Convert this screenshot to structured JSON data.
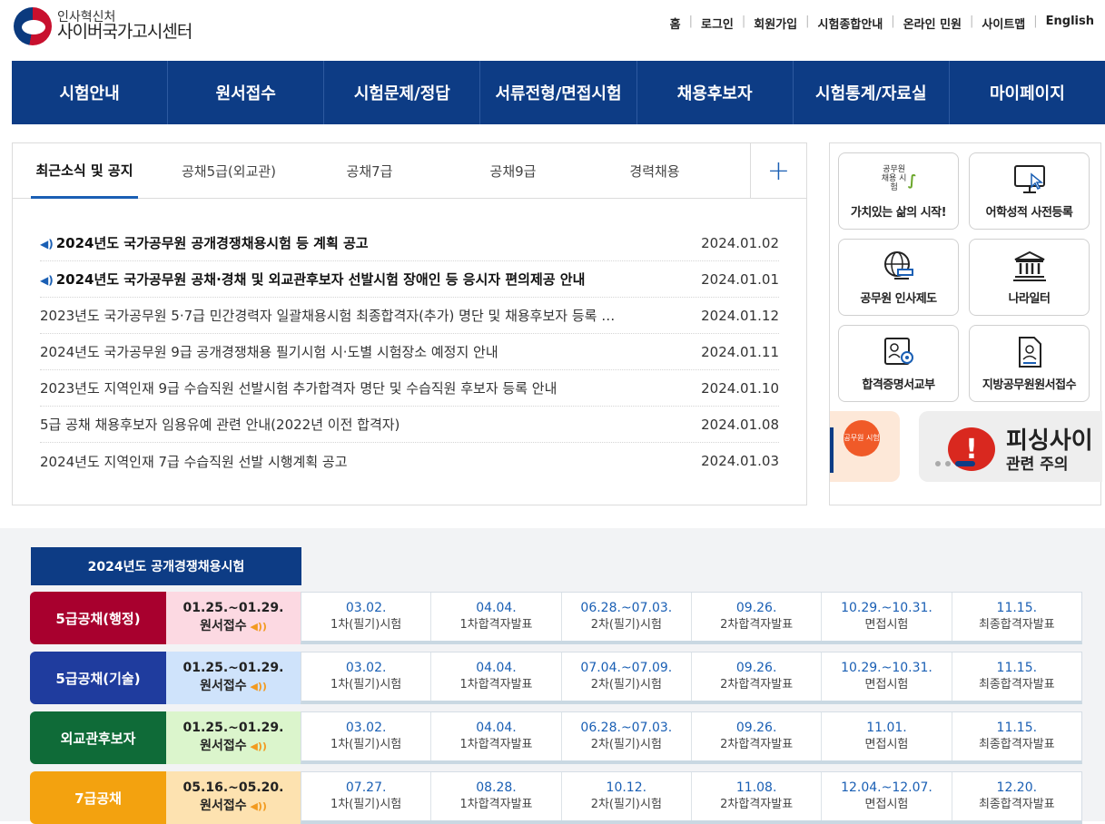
{
  "header": {
    "logo_sub": "인사혁신처",
    "logo_main": "사이버국가고시센터",
    "util_links": [
      "홈",
      "로그인",
      "회원가입",
      "시험종합안내",
      "온라인 민원",
      "사이트맵",
      "English"
    ]
  },
  "gnb": [
    "시험안내",
    "원서접수",
    "시험문제/정답",
    "서류전형/면접시험",
    "채용후보자",
    "시험통계/자료실",
    "마이페이지"
  ],
  "notice": {
    "tabs": [
      "최근소식 및 공지",
      "공채5급(외교관)",
      "공채7급",
      "공채9급",
      "경력채용"
    ],
    "more": "+",
    "items": [
      {
        "title": "2024년도 국가공무원 공개경쟁채용시험 등 계획 공고",
        "date": "2024.01.02",
        "bold": true
      },
      {
        "title": "2024년도 국가공무원 공채·경채 및 외교관후보자 선발시험 장애인 등 응시자 편의제공 안내",
        "date": "2024.01.01",
        "bold": true
      },
      {
        "title": "2023년도 국가공무원 5·7급 민간경력자 일괄채용시험 최종합격자(추가) 명단 및 채용후보자 등록 …",
        "date": "2024.01.12",
        "bold": false
      },
      {
        "title": "2024년도 국가공무원 9급 공개경쟁채용 필기시험 시·도별 시험장소 예정지 안내",
        "date": "2024.01.11",
        "bold": false
      },
      {
        "title": "2023년도 지역인재 9급 수습직원 선발시험 추가합격자 명단 및 수습직원 후보자 등록 안내",
        "date": "2024.01.10",
        "bold": false
      },
      {
        "title": "5급 공채 채용후보자 임용유예 관련 안내(2022년 이전 합격자)",
        "date": "2024.01.08",
        "bold": false
      },
      {
        "title": "2024년도 지역인재 7급 수습직원 선발 시행계획 공고",
        "date": "2024.01.03",
        "bold": false
      }
    ]
  },
  "quick": [
    {
      "label": "가치있는 삶의 시작!",
      "icon": "recruit-logo-icon",
      "icon_text": "공무원 채용 시험"
    },
    {
      "label": "어학성적 사전등록",
      "icon": "monitor-cursor-icon"
    },
    {
      "label": "공무원 인사제도",
      "icon": "globe-gavel-icon"
    },
    {
      "label": "나라일터",
      "icon": "government-building-icon"
    },
    {
      "label": "합격증명서교부",
      "icon": "certificate-icon"
    },
    {
      "label": "지방공무원원서접수",
      "icon": "document-person-icon"
    }
  ],
  "banners": {
    "b1_badge": "공무원 시험",
    "b2_title": "피싱사이",
    "b2_sub": "관련 주의 "
  },
  "schedule": {
    "title": "2024년도 공개경쟁채용시험",
    "apply_label": "원서접수",
    "rows": [
      {
        "category": "5급공채(행정)",
        "color": "#a8002e",
        "app_bg": "#fcd9e2",
        "apply": "01.25.~01.29.",
        "steps": [
          [
            "03.02.",
            "1차(필기)시험"
          ],
          [
            "04.04.",
            "1차합격자발표"
          ],
          [
            "06.28.~07.03.",
            "2차(필기)시험"
          ],
          [
            "09.26.",
            "2차합격자발표"
          ],
          [
            "10.29.~10.31.",
            "면접시험"
          ],
          [
            "11.15.",
            "최종합격자발표"
          ]
        ]
      },
      {
        "category": "5급공채(기술)",
        "color": "#1f3c9e",
        "app_bg": "#cfe3fb",
        "apply": "01.25.~01.29.",
        "steps": [
          [
            "03.02.",
            "1차(필기)시험"
          ],
          [
            "04.04.",
            "1차합격자발표"
          ],
          [
            "07.04.~07.09.",
            "2차(필기)시험"
          ],
          [
            "09.26.",
            "2차합격자발표"
          ],
          [
            "10.29.~10.31.",
            "면접시험"
          ],
          [
            "11.15.",
            "최종합격자발표"
          ]
        ]
      },
      {
        "category": "외교관후보자",
        "color": "#0f6b38",
        "app_bg": "#dbf5cc",
        "apply": "01.25.~01.29.",
        "steps": [
          [
            "03.02.",
            "1차(필기)시험"
          ],
          [
            "04.04.",
            "1차합격자발표"
          ],
          [
            "06.28.~07.03.",
            "2차(필기)시험"
          ],
          [
            "09.26.",
            "2차합격자발표"
          ],
          [
            "11.01.",
            "면접시험"
          ],
          [
            "11.15.",
            "최종합격자발표"
          ]
        ]
      },
      {
        "category": "7급공채",
        "color": "#f3a20f",
        "app_bg": "#fde2b0",
        "apply": "05.16.~05.20.",
        "steps": [
          [
            "07.27.",
            "1차(필기)시험"
          ],
          [
            "08.28.",
            "1차합격자발표"
          ],
          [
            "10.12.",
            "2차(필기)시험"
          ],
          [
            "11.08.",
            "2차합격자발표"
          ],
          [
            "12.04.~12.07.",
            "면접시험"
          ],
          [
            "12.20.",
            "최종합격자발표"
          ]
        ]
      }
    ]
  }
}
